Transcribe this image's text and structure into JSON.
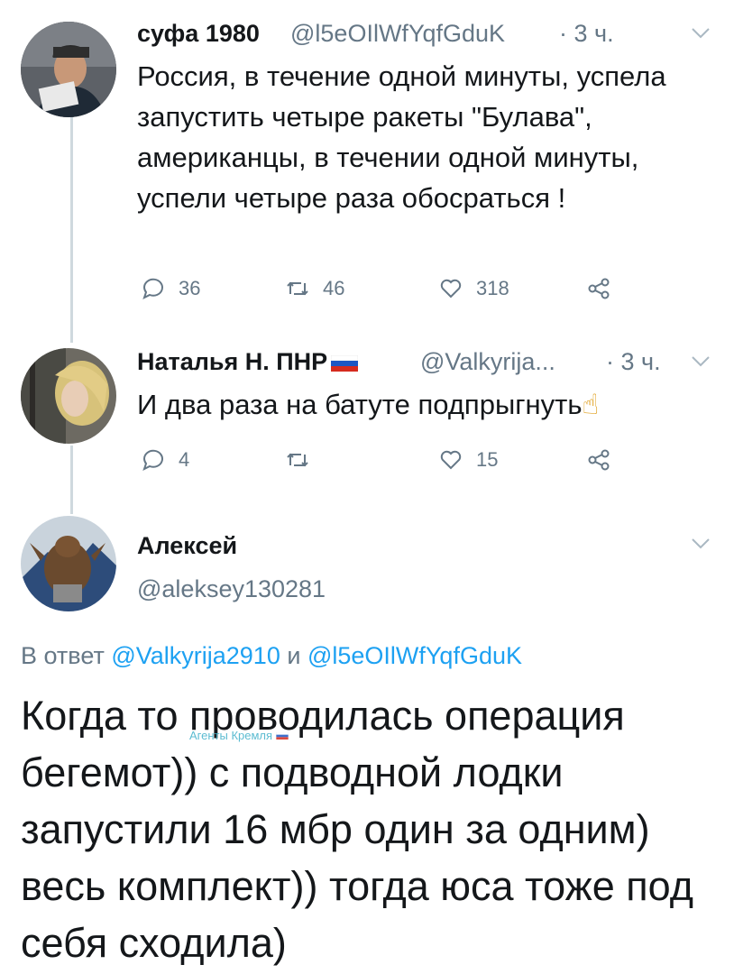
{
  "tweet1": {
    "name": "суфа 1980",
    "handle": "@l5eOIlWfYqfGduK",
    "time": "· 3 ч.",
    "text": "Россия, в течение одной минуты, успела запустить четыре ракеты \"Булава\",  американцы, в течении одной минуты, успели четыре раза обосраться !",
    "replies": "36",
    "retweets": "46",
    "likes": "318"
  },
  "tweet2": {
    "name": "Наталья Н. ПНР",
    "handle": "@Valkyrija...",
    "time": "· 3 ч.",
    "text": "И два раза на батуте подпрыгнуть",
    "emoji": "☝",
    "replies": "4",
    "retweets": "",
    "likes": "15"
  },
  "tweet3": {
    "name": "Алексей",
    "handle": "@aleksey130281",
    "reply_prefix": "В ответ",
    "reply_to_1": "@Valkyrija2910",
    "reply_and": "и",
    "reply_to_2": "@l5eOIlWfYqfGduK",
    "text": "Когда то проводилась операция бегемот)) с подводной лодки запустили 16 мбр один за одним) весь комплект)) тогда юса тоже под себя сходила)",
    "watermark": "Агенты Кремля"
  },
  "colors": {
    "accent": "#1da1f2",
    "muted": "#657786",
    "text": "#14171a"
  }
}
